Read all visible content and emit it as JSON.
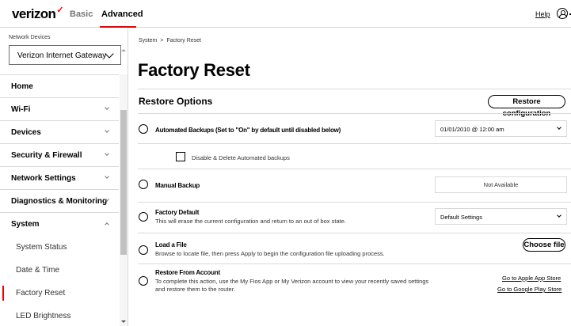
{
  "header": {
    "logo": "verizon",
    "logo_check": "✓",
    "tabs": [
      "Basic",
      "Advanced"
    ],
    "active_tab": "Advanced",
    "help": "Help",
    "accent_color": "#ee0000"
  },
  "sidebar": {
    "device_label": "Network Devices",
    "device_selected": "Verizon Internet Gateway",
    "menu": [
      {
        "label": "Home",
        "expandable": false
      },
      {
        "label": "Wi-Fi",
        "expandable": true
      },
      {
        "label": "Devices",
        "expandable": true
      },
      {
        "label": "Security & Firewall",
        "expandable": true
      },
      {
        "label": "Network Settings",
        "expandable": true
      },
      {
        "label": "Diagnostics & Monitoring",
        "expandable": true
      },
      {
        "label": "System",
        "expandable": true,
        "expanded": true
      }
    ],
    "submenu": [
      "System Status",
      "Date & Time",
      "Factory Reset",
      "LED Brightness"
    ],
    "active_submenu": "Factory Reset"
  },
  "breadcrumb": [
    "System",
    "Factory Reset"
  ],
  "breadcrumb_sep": ">",
  "page_title": "Factory Reset",
  "section": {
    "title": "Restore Options",
    "restore_button": "Restore configuration"
  },
  "options": {
    "automated": {
      "title": "Automated Backups (Set to \"On\" by default until disabled below)",
      "selected_value": "01/01/2010 @ 12:00 am",
      "checkbox_label": "Disable & Delete Automated backups"
    },
    "manual": {
      "title": "Manual Backup",
      "value": "Not Available"
    },
    "factory": {
      "title": "Factory Default",
      "desc": "This will erase the current configuration and return to an out of box state.",
      "selected_value": "Default Settings"
    },
    "load": {
      "title": "Load a File",
      "desc": "Browse to locate file, then press Apply to begin the configuration file uploading process.",
      "button": "Choose file"
    },
    "account": {
      "title": "Restore From Account",
      "desc_line1": "To complete this action, use the My Fios App or My Verizon account to view your recently saved settings",
      "desc_line2": "and restore them to the router.",
      "apple_link": "Go to Apple App Store",
      "google_link": "Go to Google Play Store"
    }
  }
}
